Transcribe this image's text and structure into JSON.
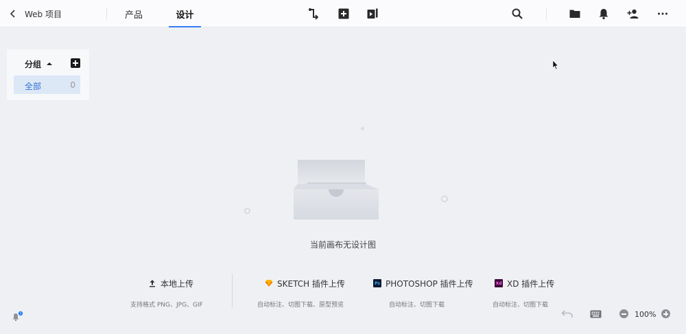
{
  "topbar": {
    "project_name": "Web 项目",
    "tabs": [
      {
        "label": "产品"
      },
      {
        "label": "设计"
      }
    ]
  },
  "groups": {
    "title": "分组",
    "items": [
      {
        "label": "全部",
        "count": "0"
      }
    ]
  },
  "empty_state": {
    "message": "当前画布无设计图"
  },
  "upload": {
    "local": {
      "label": "本地上传",
      "sub": "支持格式 PNG、JPG、GIF"
    },
    "sketch": {
      "label": "SKETCH 插件上传",
      "sub": "自动标注、切图下载、原型预览"
    },
    "photoshop": {
      "label": "PHOTOSHOP 插件上传",
      "sub": "自动标注、切图下载",
      "badge": "Ps"
    },
    "xd": {
      "label": "XD 插件上传",
      "sub": "自动标注、切图下载",
      "badge": "Xd"
    }
  },
  "zoom": {
    "level": "100%"
  },
  "icons": {
    "topbar_center": [
      "connector-icon",
      "add-board-icon",
      "prototype-play-icon"
    ],
    "topbar_right": [
      "search-icon",
      "folder-icon",
      "bell-icon",
      "add-member-icon",
      "more-icon"
    ]
  },
  "colors": {
    "accent": "#2f7ef5",
    "selected_group_bg": "#dce8f6",
    "canvas_bg": "#eff0f4"
  }
}
